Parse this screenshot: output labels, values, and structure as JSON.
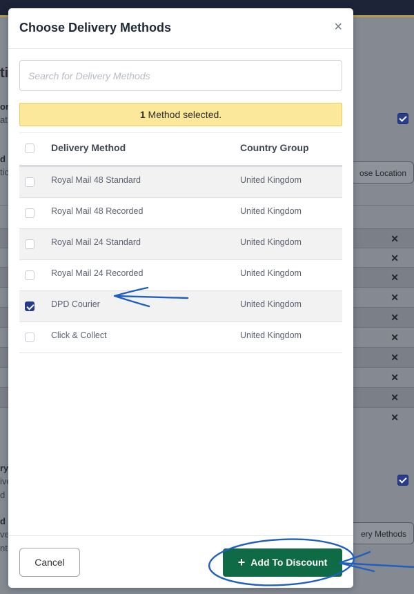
{
  "background": {
    "fragments": [
      "ti",
      "or",
      "at",
      "d",
      "tic",
      "ry",
      "ive",
      "d",
      "d",
      "ve",
      "nt"
    ],
    "choose_location_label": "ose Location",
    "delivery_methods_label": "ery Methods"
  },
  "modal": {
    "title": "Choose Delivery Methods",
    "close_label": "×",
    "search_placeholder": "Search for Delivery Methods",
    "selection_count": "1",
    "selection_text": "Method selected.",
    "columns": [
      "Delivery Method",
      "Country Group"
    ],
    "rows": [
      {
        "method": "Royal Mail 48 Standard",
        "group": "United Kingdom",
        "checked": false
      },
      {
        "method": "Royal Mail 48 Recorded",
        "group": "United Kingdom",
        "checked": false
      },
      {
        "method": "Royal Mail 24 Standard",
        "group": "United Kingdom",
        "checked": false
      },
      {
        "method": "Royal Mail 24 Recorded",
        "group": "United Kingdom",
        "checked": false
      },
      {
        "method": "DPD Courier",
        "group": "United Kingdom",
        "checked": true
      },
      {
        "method": "Click & Collect",
        "group": "United Kingdom",
        "checked": false
      }
    ],
    "cancel_label": "Cancel",
    "add_label": "Add To Discount",
    "add_icon": "plus-icon"
  },
  "colors": {
    "primary_button": "#0f6b45",
    "checkbox_checked": "#243a8f",
    "alert_bg": "#fbe89a",
    "annotation": "#1f5fbf"
  }
}
